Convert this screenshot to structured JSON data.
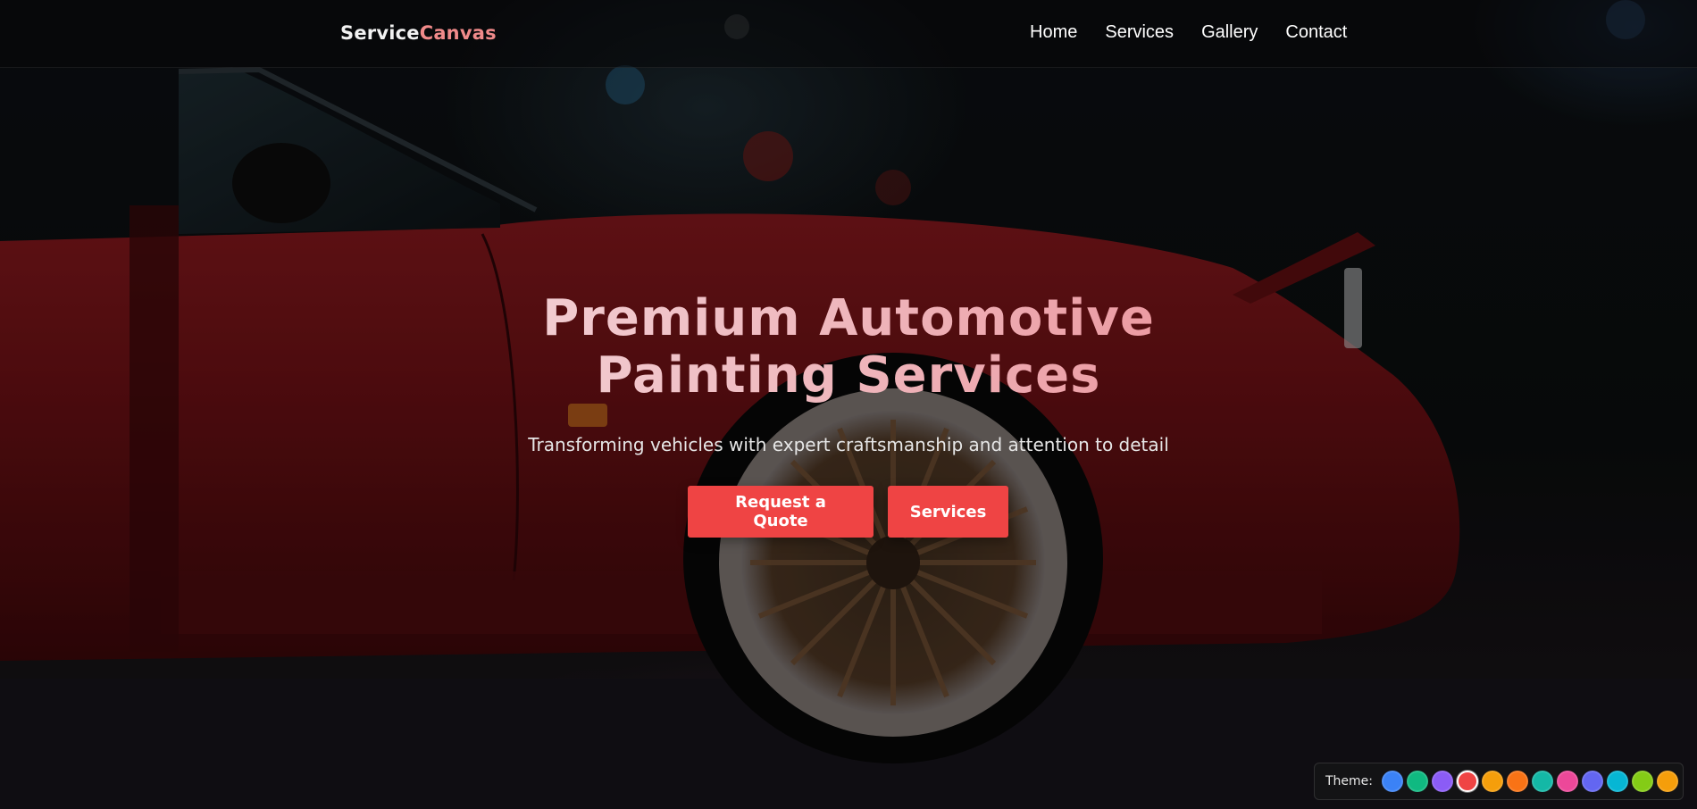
{
  "brand": {
    "part1": "Service",
    "part2": "Canvas"
  },
  "nav": {
    "items": [
      {
        "label": "Home"
      },
      {
        "label": "Services"
      },
      {
        "label": "Gallery"
      },
      {
        "label": "Contact"
      }
    ]
  },
  "hero": {
    "title_line1": "Premium Automotive",
    "title_line2": "Painting Services",
    "subtitle": "Transforming vehicles with expert craftsmanship and attention to detail",
    "primary_button": "Request a Quote",
    "secondary_button": "Services",
    "background_image": "red-sports-car-at-night"
  },
  "theme": {
    "label": "Theme:",
    "active_index": 3,
    "swatches": [
      {
        "color": "#3b82f6"
      },
      {
        "color": "#10b981"
      },
      {
        "color": "#8b5cf6"
      },
      {
        "color": "#ef4444"
      },
      {
        "color": "#f59e0b"
      },
      {
        "color": "#f97316"
      },
      {
        "color": "#14b8a6"
      },
      {
        "color": "#ec4899"
      },
      {
        "color": "#6366f1"
      },
      {
        "color": "#06b6d4"
      },
      {
        "color": "#84cc16"
      },
      {
        "color": "#f59e0b"
      }
    ]
  },
  "colors": {
    "accent": "#ef4444",
    "brand_highlight": "#f08a8a"
  }
}
